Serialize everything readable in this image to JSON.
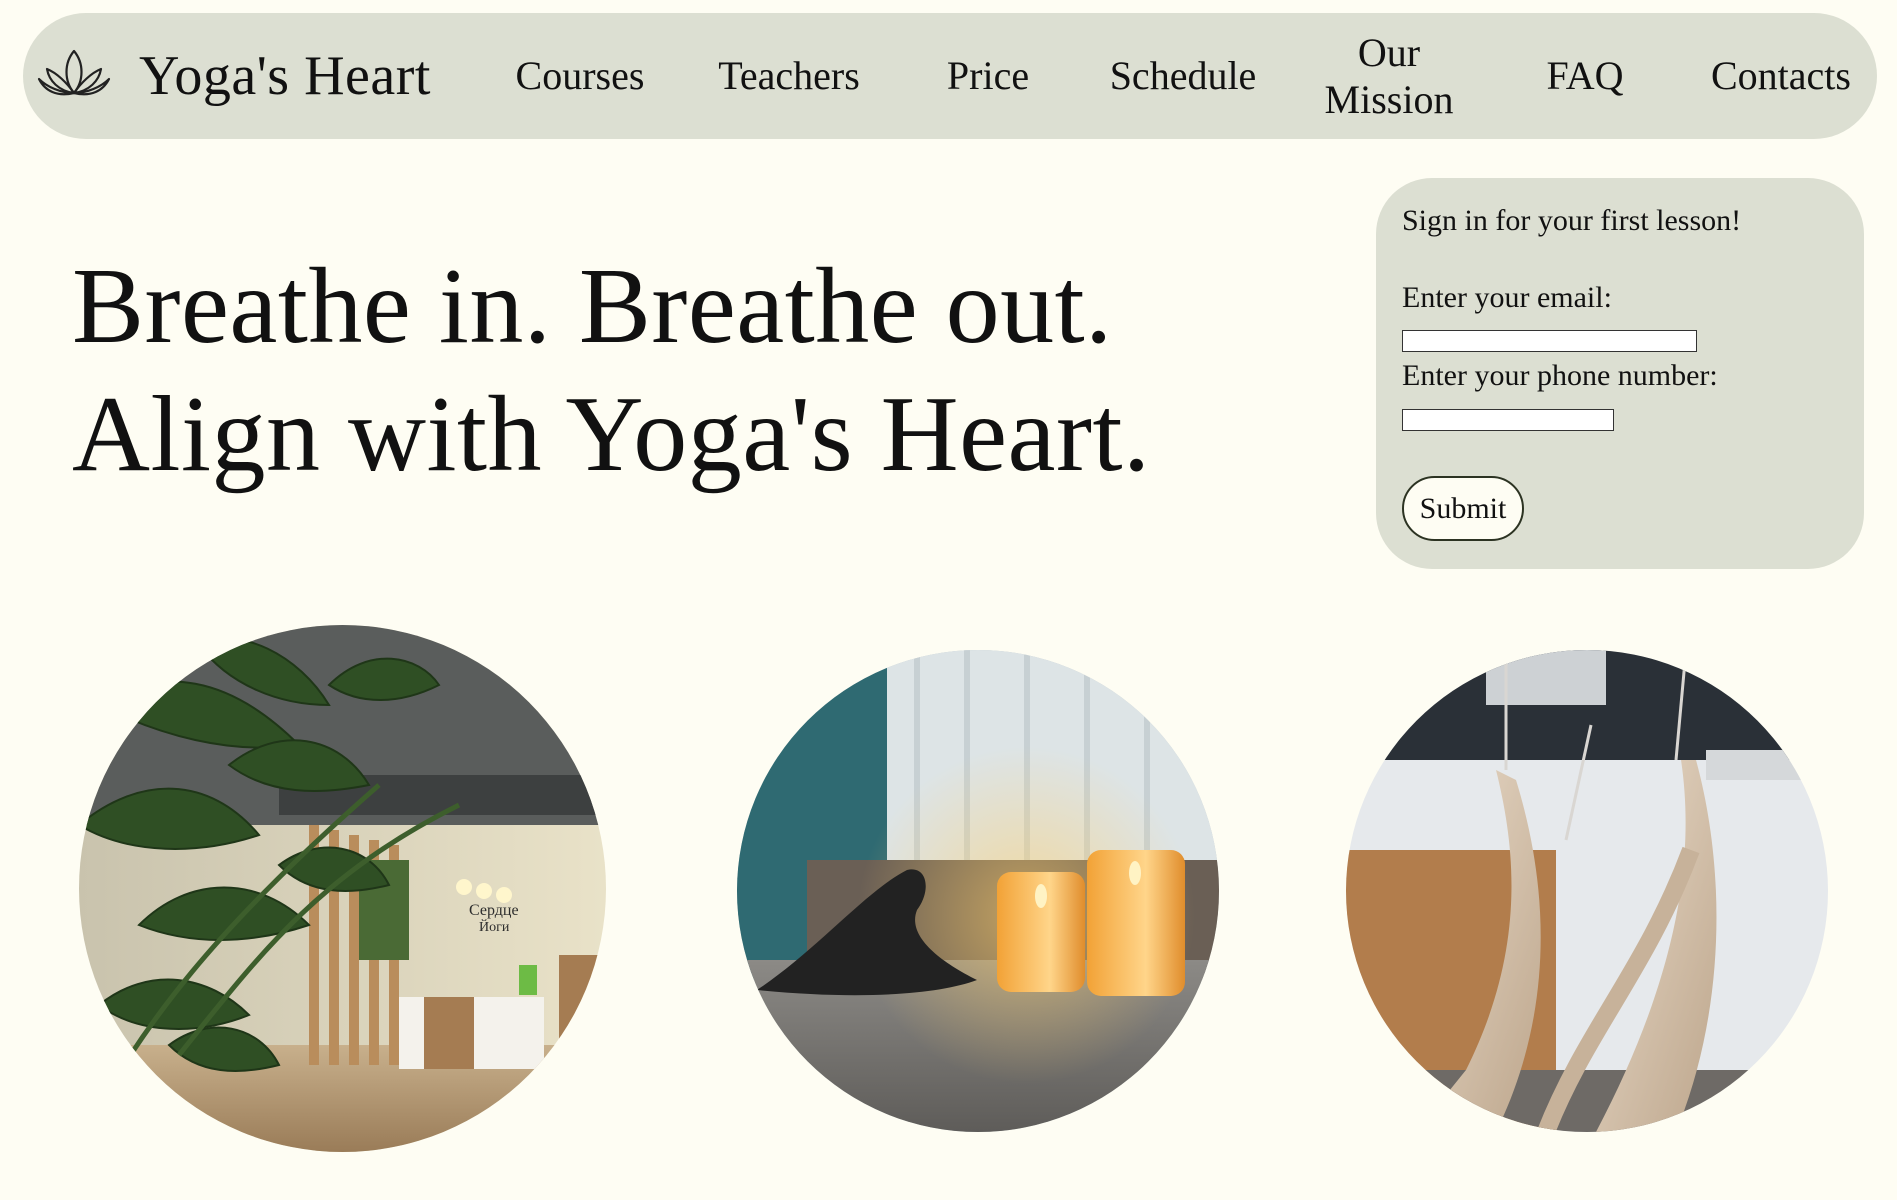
{
  "nav": {
    "logo_icon": "lotus-icon",
    "brand": "Yoga's Heart",
    "items": [
      {
        "label": "Courses"
      },
      {
        "label": "Teachers"
      },
      {
        "label": "Price"
      },
      {
        "label": "Schedule"
      },
      {
        "label_line1": "Our",
        "label_line2": "Mission"
      },
      {
        "label": "FAQ"
      },
      {
        "label": "Contacts"
      }
    ]
  },
  "hero": {
    "line1": "Breathe in. Breathe out.",
    "line2": "Align with Yoga's Heart."
  },
  "signup": {
    "title": "Sign in for your first lesson!",
    "email_label": "Enter your email:",
    "email_value": "",
    "phone_label": "Enter your phone number:",
    "phone_value": "",
    "submit_label": "Submit"
  },
  "photos": [
    {
      "name": "studio-reception-photo",
      "sign_line1": "Сердце",
      "sign_line2": "Йоги"
    },
    {
      "name": "candles-photo"
    },
    {
      "name": "aerial-hammocks-photo"
    }
  ],
  "colors": {
    "background": "#fefdf3",
    "panel": "#dcdfd2",
    "text": "#111111"
  }
}
